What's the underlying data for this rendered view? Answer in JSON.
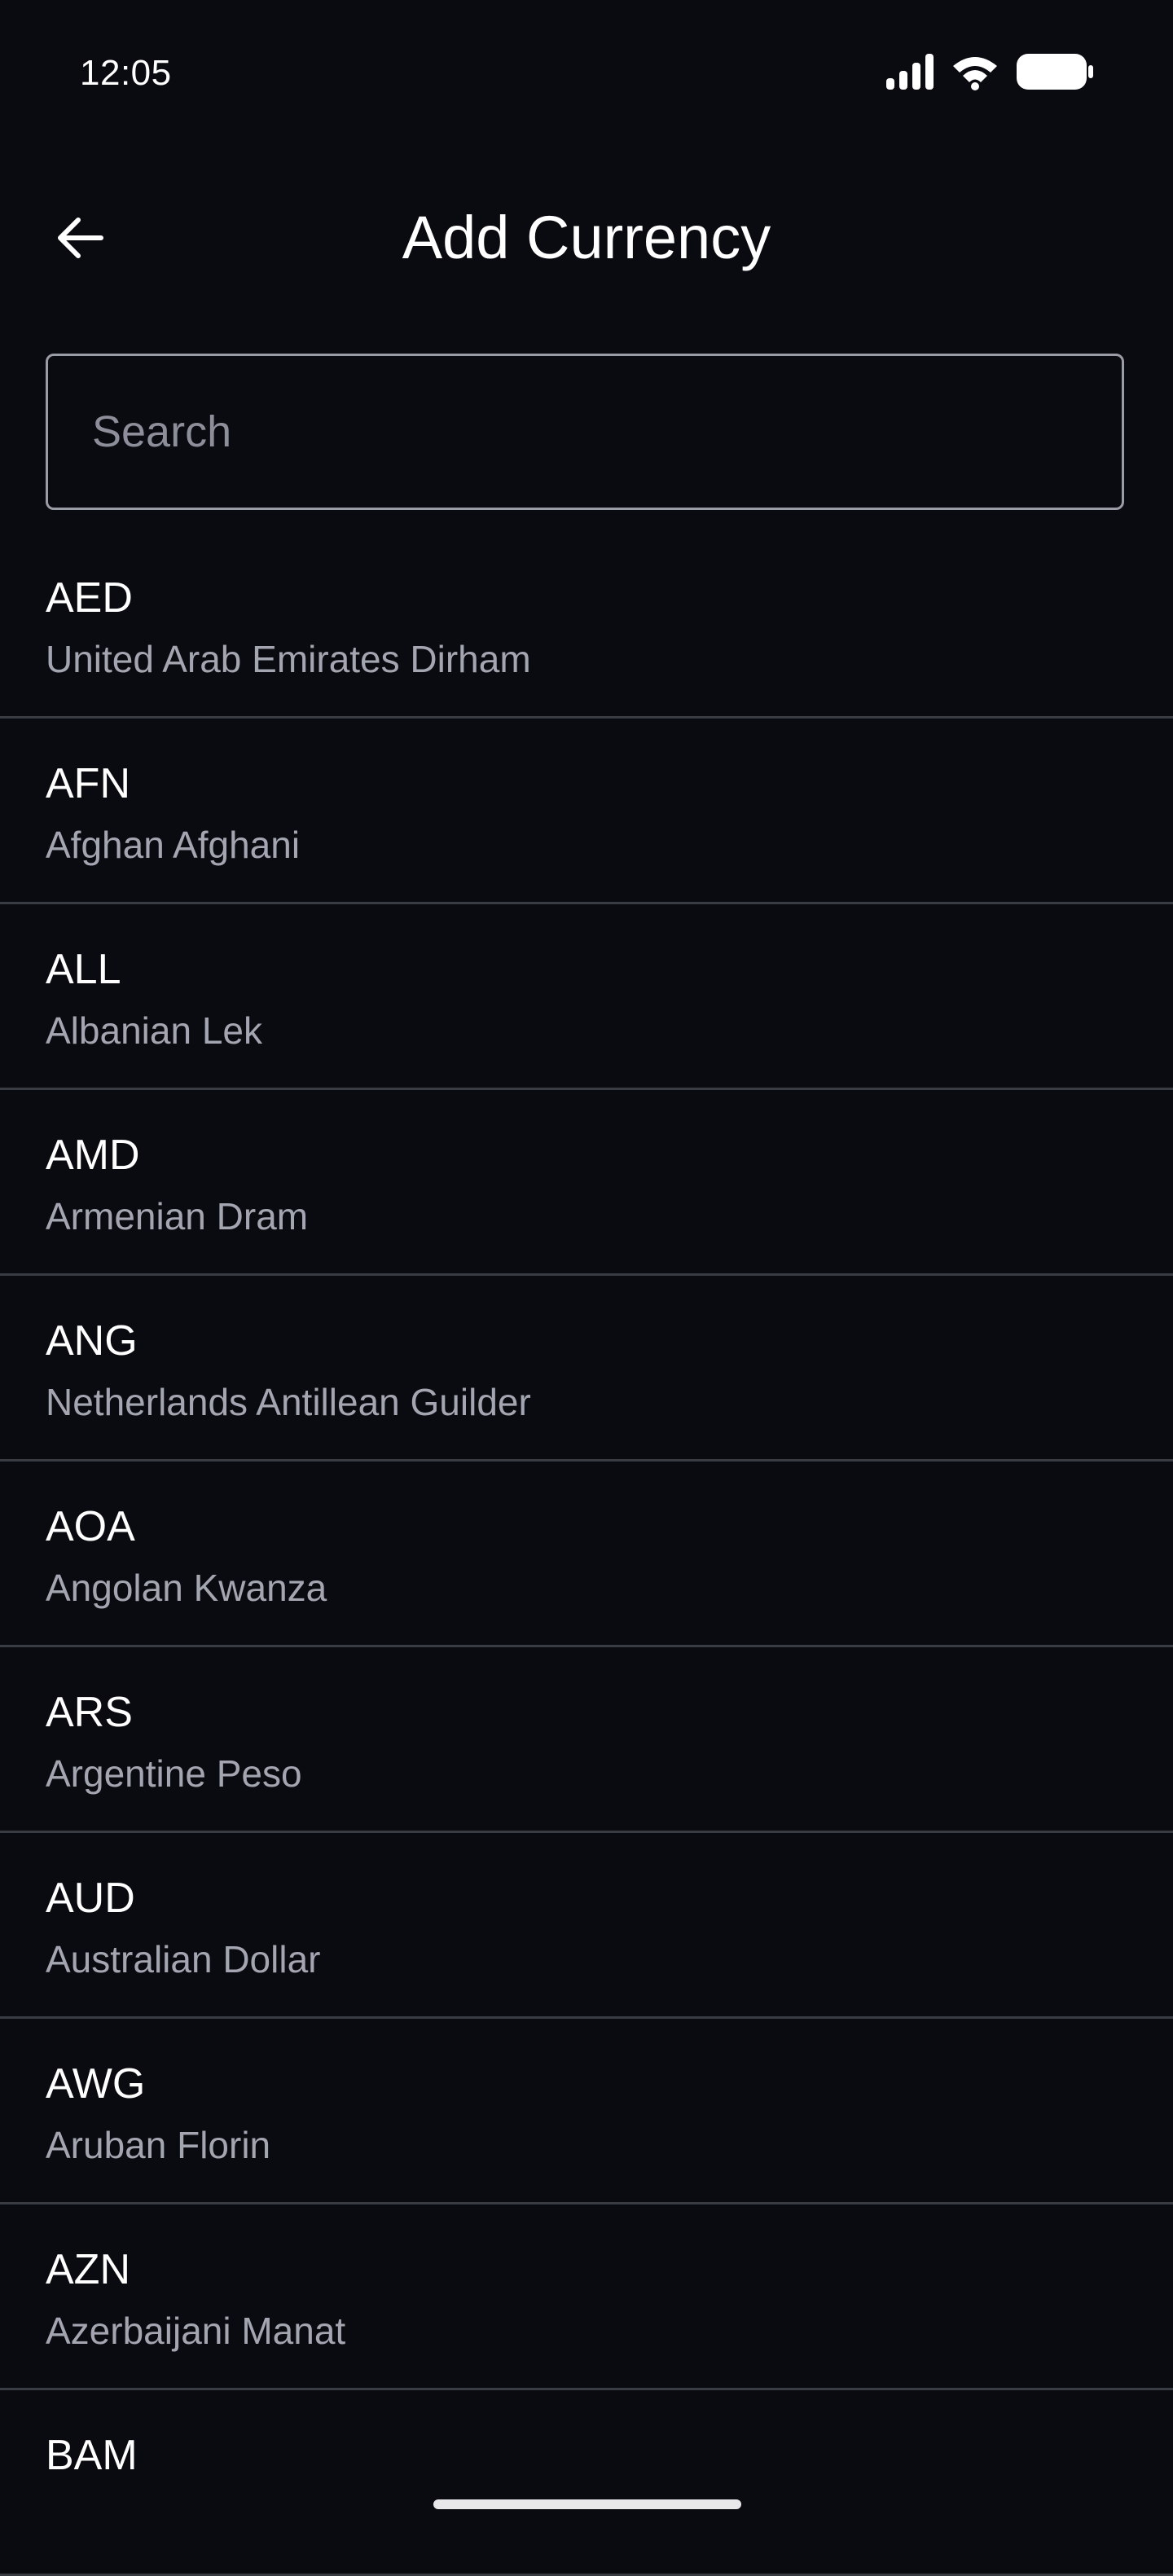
{
  "status_bar": {
    "time": "12:05",
    "icons": [
      "signal-icon",
      "wifi-icon",
      "battery-icon"
    ]
  },
  "app_bar": {
    "back_icon": "arrow-left-icon",
    "title": "Add Currency"
  },
  "search": {
    "placeholder": "Search",
    "value": ""
  },
  "currencies": [
    {
      "code": "AED",
      "name": "United Arab Emirates Dirham"
    },
    {
      "code": "AFN",
      "name": "Afghan Afghani"
    },
    {
      "code": "ALL",
      "name": "Albanian Lek"
    },
    {
      "code": "AMD",
      "name": "Armenian Dram"
    },
    {
      "code": "ANG",
      "name": "Netherlands Antillean Guilder"
    },
    {
      "code": "AOA",
      "name": "Angolan Kwanza"
    },
    {
      "code": "ARS",
      "name": "Argentine Peso"
    },
    {
      "code": "AUD",
      "name": "Australian Dollar"
    },
    {
      "code": "AWG",
      "name": "Aruban Florin"
    },
    {
      "code": "AZN",
      "name": "Azerbaijani Manat"
    },
    {
      "code": "BAM",
      "name": ""
    }
  ],
  "colors": {
    "background": "#0a0b10",
    "primary_text": "#ffffff",
    "secondary_text": "#a3a6b0",
    "divider": "#3a3c44",
    "search_border": "#9a9ca6"
  }
}
